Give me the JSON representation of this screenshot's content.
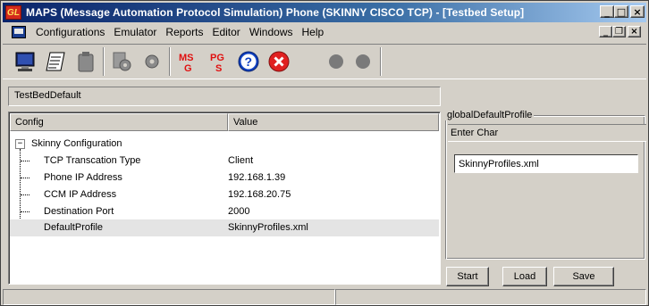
{
  "window": {
    "title": "MAPS (Message Automation Protocol Simulation) Phone (SKINNY CISCO TCP) - [Testbed Setup]",
    "logo_text": "GL",
    "controls": [
      "minimize",
      "restore",
      "close"
    ]
  },
  "menu": {
    "items": [
      "Configurations",
      "Emulator",
      "Reports",
      "Editor",
      "Windows",
      "Help"
    ]
  },
  "toolbar": {
    "buttons": [
      {
        "icon": "monitor-icon"
      },
      {
        "icon": "notepad-icon"
      },
      {
        "icon": "clipboard-icon"
      },
      {
        "icon": "gear-doc-icon"
      },
      {
        "icon": "gear-icon"
      },
      {
        "icon": "msg-icon",
        "text": "MSG"
      },
      {
        "icon": "pgs-icon",
        "text": "PGS"
      },
      {
        "icon": "help-icon",
        "text": "?"
      },
      {
        "icon": "exit-icon",
        "text": "✕"
      },
      {
        "icon": "status-dot-icon"
      },
      {
        "icon": "status-dot-icon"
      }
    ]
  },
  "testbed": {
    "name": "TestBedDefault"
  },
  "config_table": {
    "columns": [
      "Config",
      "Value"
    ],
    "group": "Skinny Configuration",
    "expander": "−",
    "rows": [
      {
        "label": "TCP Transcation Type",
        "value": "Client"
      },
      {
        "label": "Phone IP Address",
        "value": "192.168.1.39"
      },
      {
        "label": "CCM IP Address",
        "value": "192.168.20.75"
      },
      {
        "label": "Destination Port",
        "value": "2000"
      },
      {
        "label": "DefaultProfile",
        "value": "SkinnyProfiles.xml"
      }
    ],
    "selected_index": 4
  },
  "profile": {
    "group_label": "globalDefaultProfile",
    "prompt": "Enter Char",
    "value": "SkinnyProfiles.xml"
  },
  "actions": {
    "start": "Start",
    "load": "Load",
    "save": "Save"
  }
}
